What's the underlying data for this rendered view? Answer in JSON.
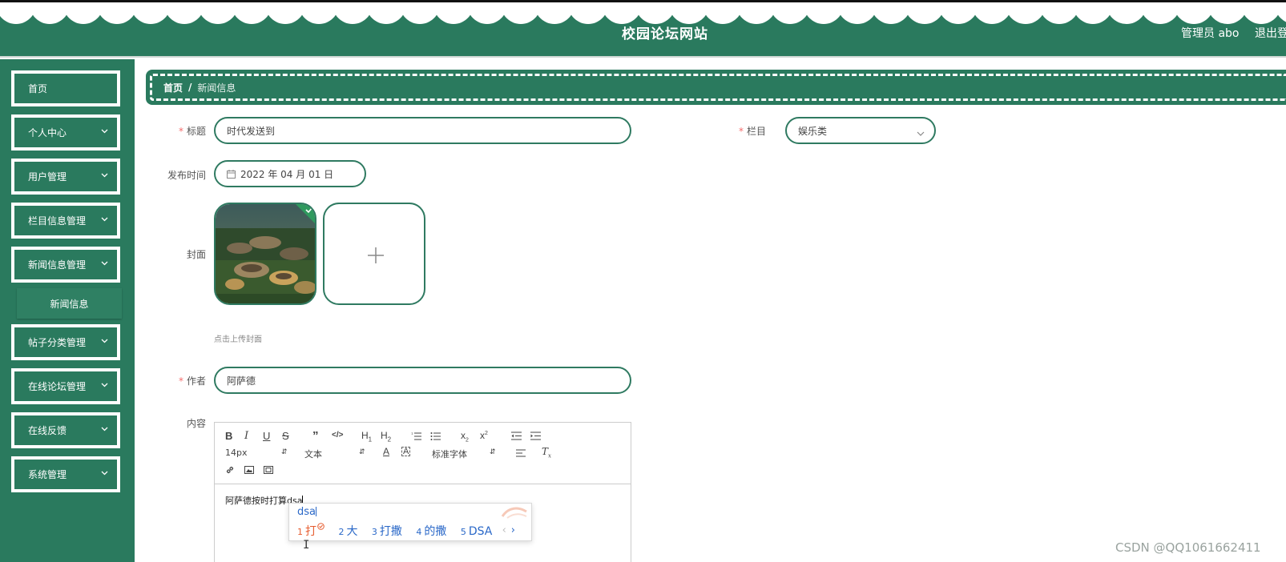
{
  "header": {
    "title": "校园论坛网站",
    "user": "管理员 abo",
    "logout": "退出登"
  },
  "sidebar": {
    "items": [
      {
        "label": "首页",
        "has_chevron": false
      },
      {
        "label": "个人中心",
        "has_chevron": true
      },
      {
        "label": "用户管理",
        "has_chevron": true
      },
      {
        "label": "栏目信息管理",
        "has_chevron": true
      },
      {
        "label": "新闻信息管理",
        "has_chevron": true
      },
      {
        "label": "帖子分类管理",
        "has_chevron": true
      },
      {
        "label": "在线论坛管理",
        "has_chevron": true
      },
      {
        "label": "在线反馈",
        "has_chevron": true
      },
      {
        "label": "系统管理",
        "has_chevron": true
      }
    ],
    "sub_item": "新闻信息"
  },
  "breadcrumb": {
    "home": "首页",
    "separator": "/",
    "current": "新闻信息"
  },
  "form": {
    "title_label": "标题",
    "title_value": "时代发送到",
    "column_label": "栏目",
    "column_value": "娱乐类",
    "date_label": "发布时间",
    "date_value": "2022 年 04 月 01 日",
    "cover_label": "封面",
    "cover_hint": "点击上传封面",
    "author_label": "作者",
    "author_value": "阿萨德",
    "content_label": "内容",
    "required_mark": "*"
  },
  "editor": {
    "font_size": "14px",
    "header_select": "文本",
    "font_family": "标准字体",
    "content": "阿萨德按时打算dsa"
  },
  "ime": {
    "typed": "dsa",
    "candidates": [
      {
        "n": "1",
        "text": "打"
      },
      {
        "n": "2",
        "text": "大"
      },
      {
        "n": "3",
        "text": "打撒"
      },
      {
        "n": "4",
        "text": "的撒"
      },
      {
        "n": "5",
        "text": "DSA"
      }
    ]
  },
  "watermark": "CSDN @QQ1061662411",
  "colors": {
    "primary": "#2a7a5e",
    "required": "#f56c6c",
    "ime_blue": "#2a68c8",
    "ime_first": "#e65c2f"
  }
}
